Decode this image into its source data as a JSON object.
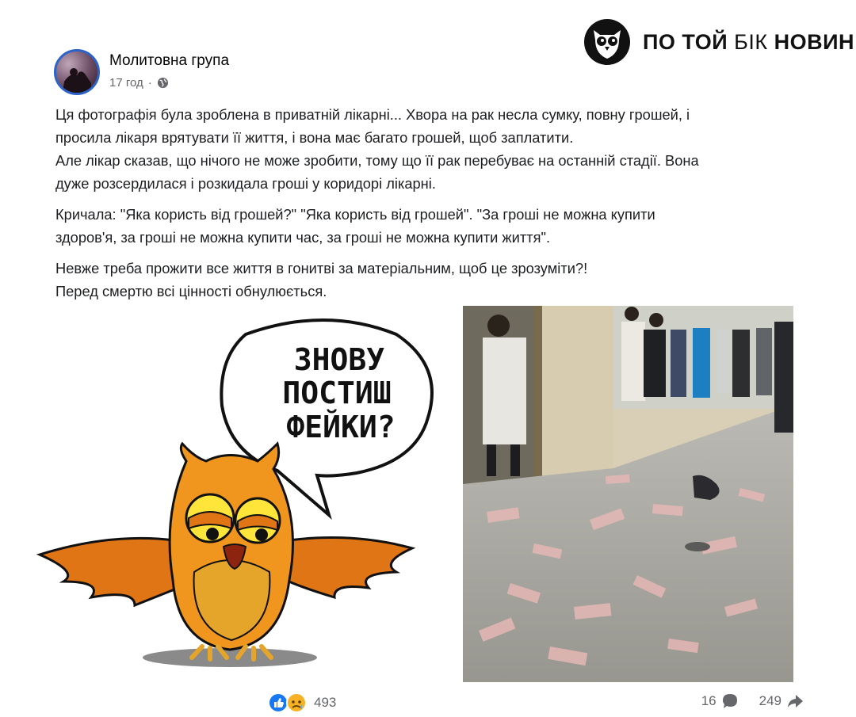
{
  "brand": {
    "name_bold_1": "ПО ТОЙ",
    "name_light": "БІК",
    "name_bold_2": "НОВИН"
  },
  "post": {
    "group_name": "Молитовна група",
    "time": "17 год",
    "dot": "·",
    "paragraphs": [
      {
        "lines": [
          "Ця фотографія була зроблена в приватній лікарні... Хвора на рак несла сумку, повну грошей, і",
          "просила лікаря врятувати її життя, і вона має багато грошей, щоб заплатити.",
          "Але лікар сказав, що нічого не може зробити, тому що її рак перебуває на останній стадії. Вона",
          "дуже розсердилася і розкидала гроші у коридорі лікарні."
        ]
      },
      {
        "lines": [
          "Кричала: \"Яка користь від грошей?\" \"Яка користь від грошей\". \"За гроші не можна купити",
          "здоров'я, за гроші не можна купити час, за гроші не можна купити життя\"."
        ]
      },
      {
        "lines": [
          "Невже треба прожити все життя в гонитві за матеріальним, щоб це зрозуміти?!",
          "Перед смертю всі цінності обнулюється."
        ]
      }
    ]
  },
  "cartoon": {
    "bubble_lines": [
      "ЗНОВУ",
      "ПОСТИШ",
      "ФЕЙКИ?"
    ]
  },
  "footer": {
    "reactions_count": "493",
    "comments_count": "16",
    "shares_count": "249"
  },
  "colors": {
    "like_blue": "#1877f2",
    "sad_yellow": "#f7b125",
    "owl_orange": "#e8861a",
    "meta_gray": "#65676b"
  }
}
